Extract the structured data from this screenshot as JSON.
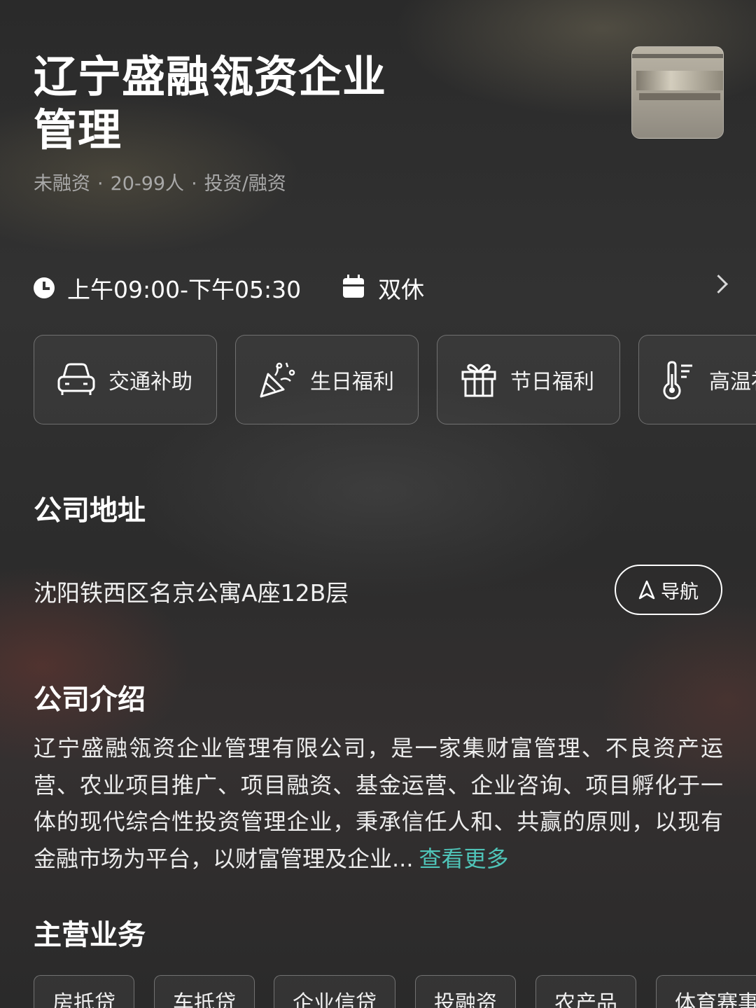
{
  "company": {
    "name": "辽宁盛融瓴资企业管理",
    "logo_text": "LIAO NING",
    "financing": "未融资",
    "size": "20-99人",
    "industry": "投资/融资",
    "separator": "·"
  },
  "work": {
    "hours": "上午09:00-下午05:30",
    "rest": "双休"
  },
  "welfare": [
    {
      "label": "交通补助",
      "icon": "car-icon"
    },
    {
      "label": "生日福利",
      "icon": "party-popper-icon"
    },
    {
      "label": "节日福利",
      "icon": "gift-icon"
    },
    {
      "label": "高温补贴",
      "icon": "thermometer-icon"
    }
  ],
  "address_section": {
    "title": "公司地址",
    "address": "沈阳铁西区名京公寓A座12B层",
    "nav_label": "导航"
  },
  "intro_section": {
    "title": "公司介绍",
    "text": "辽宁盛融瓴资企业管理有限公司，是一家集财富管理、不良资产运营、农业项目推广、项目融资、基金运营、企业咨询、项目孵化于一体的现代综合性投资管理企业，秉承信任人和、共赢的原则，以现有金融市场为平台，以财富管理及企业...",
    "more_label": "查看更多",
    "more_color": "#4fc4b8"
  },
  "business_section": {
    "title": "主营业务",
    "tags": [
      "房抵贷",
      "车抵贷",
      "企业信贷",
      "投融资",
      "农产品",
      "体育赛事"
    ]
  }
}
